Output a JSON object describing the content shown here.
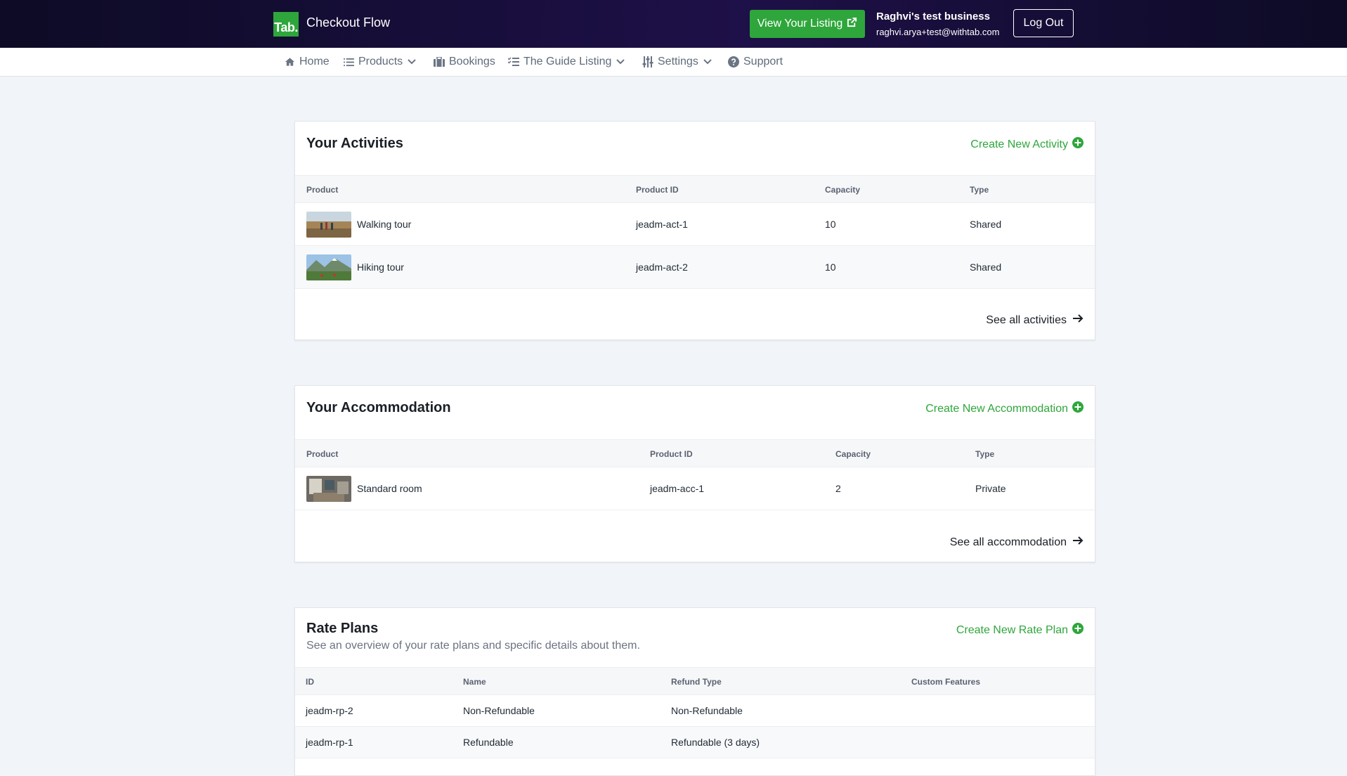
{
  "header": {
    "logo_text": "Tab.",
    "app_title": "Checkout Flow",
    "view_listing_label": "View Your Listing",
    "business_name": "Raghvi's test business",
    "business_email": "raghvi.arya+test@withtab.com",
    "logout_label": "Log Out"
  },
  "nav": {
    "home": "Home",
    "products": "Products",
    "bookings": "Bookings",
    "guide_listing": "The Guide Listing",
    "settings": "Settings",
    "support": "Support"
  },
  "activities": {
    "title": "Your Activities",
    "create_label": "Create New Activity",
    "columns": [
      "Product",
      "Product ID",
      "Capacity",
      "Type"
    ],
    "rows": [
      {
        "product": "Walking tour",
        "id": "jeadm-act-1",
        "capacity": "10",
        "type": "Shared"
      },
      {
        "product": "Hiking tour",
        "id": "jeadm-act-2",
        "capacity": "10",
        "type": "Shared"
      }
    ],
    "see_all_label": "See all activities"
  },
  "accommodation": {
    "title": "Your Accommodation",
    "create_label": "Create New Accommodation",
    "columns": [
      "Product",
      "Product ID",
      "Capacity",
      "Type"
    ],
    "rows": [
      {
        "product": "Standard room",
        "id": "jeadm-acc-1",
        "capacity": "2",
        "type": "Private"
      }
    ],
    "see_all_label": "See all accommodation"
  },
  "rate_plans": {
    "title": "Rate Plans",
    "subtitle": "See an overview of your rate plans and specific details about them.",
    "create_label": "Create New Rate Plan",
    "columns": [
      "ID",
      "Name",
      "Refund Type",
      "Custom Features"
    ],
    "rows": [
      {
        "id": "jeadm-rp-2",
        "name": "Non-Refundable",
        "refund_type": "Non-Refundable",
        "custom_features": ""
      },
      {
        "id": "jeadm-rp-1",
        "name": "Refundable",
        "refund_type": "Refundable (3 days)",
        "custom_features": ""
      }
    ]
  },
  "colors": {
    "brand_green": "#2ea63b",
    "header_dark": "#1e1048",
    "page_bg": "#f1f4f8"
  }
}
